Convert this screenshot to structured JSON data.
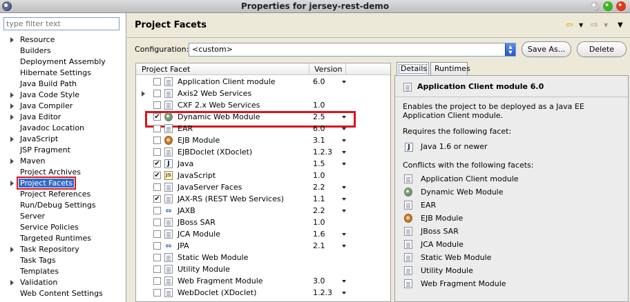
{
  "window": {
    "title": "Properties for jersey-rest-demo"
  },
  "sidebar": {
    "filter_placeholder": "type filter text",
    "items": [
      {
        "label": "Resource",
        "expandable": true
      },
      {
        "label": "Builders",
        "expandable": false
      },
      {
        "label": "Deployment Assembly",
        "expandable": false
      },
      {
        "label": "Hibernate Settings",
        "expandable": false
      },
      {
        "label": "Java Build Path",
        "expandable": false
      },
      {
        "label": "Java Code Style",
        "expandable": true
      },
      {
        "label": "Java Compiler",
        "expandable": true
      },
      {
        "label": "Java Editor",
        "expandable": true
      },
      {
        "label": "Javadoc Location",
        "expandable": false
      },
      {
        "label": "JavaScript",
        "expandable": true
      },
      {
        "label": "JSP Fragment",
        "expandable": false
      },
      {
        "label": "Maven",
        "expandable": true
      },
      {
        "label": "Project Archives",
        "expandable": false
      },
      {
        "label": "Project Facets",
        "expandable": true,
        "selected": true
      },
      {
        "label": "Project References",
        "expandable": false
      },
      {
        "label": "Run/Debug Settings",
        "expandable": false
      },
      {
        "label": "Server",
        "expandable": false
      },
      {
        "label": "Service Policies",
        "expandable": false
      },
      {
        "label": "Targeted Runtimes",
        "expandable": false
      },
      {
        "label": "Task Repository",
        "expandable": true
      },
      {
        "label": "Task Tags",
        "expandable": false
      },
      {
        "label": "Templates",
        "expandable": false
      },
      {
        "label": "Validation",
        "expandable": true
      },
      {
        "label": "Web Content Settings",
        "expandable": false
      }
    ]
  },
  "header": {
    "title": "Project Facets",
    "back_icon": "back-arrow-icon",
    "forward_icon": "forward-arrow-icon"
  },
  "configuration": {
    "label": "Configuration:",
    "value": "<custom>",
    "save_as_label": "Save As...",
    "delete_label": "Delete"
  },
  "facets": {
    "col_facet": "Project Facet",
    "col_version": "Version",
    "rows": [
      {
        "name": "Application Client module",
        "version": "6.0",
        "checked": false,
        "icon": "doc",
        "dropdown": true
      },
      {
        "name": "Axis2 Web Services",
        "version": "",
        "checked": false,
        "icon": "doc",
        "expandable": true,
        "dropdown": false
      },
      {
        "name": "CXF 2.x Web Services",
        "version": "1.0",
        "checked": false,
        "icon": "doc",
        "dropdown": false
      },
      {
        "name": "Dynamic Web Module",
        "version": "2.5",
        "checked": true,
        "icon": "globe",
        "dropdown": true,
        "highlight": true
      },
      {
        "name": "EAR",
        "version": "6.0",
        "checked": false,
        "icon": "doc",
        "dropdown": true
      },
      {
        "name": "EJB Module",
        "version": "3.1",
        "checked": false,
        "icon": "bean",
        "dropdown": true
      },
      {
        "name": "EJBDoclet (XDoclet)",
        "version": "1.2.3",
        "checked": false,
        "icon": "doc",
        "dropdown": true
      },
      {
        "name": "Java",
        "version": "1.5",
        "checked": true,
        "icon": "java",
        "dropdown": true
      },
      {
        "name": "JavaScript",
        "version": "1.0",
        "checked": true,
        "icon": "js",
        "dropdown": false
      },
      {
        "name": "JavaServer Faces",
        "version": "2.2",
        "checked": false,
        "icon": "doc",
        "dropdown": true
      },
      {
        "name": "JAX-RS (REST Web Services)",
        "version": "1.1",
        "checked": true,
        "icon": "doc",
        "dropdown": true
      },
      {
        "name": "JAXB",
        "version": "2.2",
        "checked": false,
        "icon": "arrows",
        "dropdown": true
      },
      {
        "name": "JBoss SAR",
        "version": "1.0",
        "checked": false,
        "icon": "doc",
        "dropdown": false
      },
      {
        "name": "JCA Module",
        "version": "1.6",
        "checked": false,
        "icon": "doc",
        "dropdown": true
      },
      {
        "name": "JPA",
        "version": "2.1",
        "checked": false,
        "icon": "arrows",
        "dropdown": true
      },
      {
        "name": "Static Web Module",
        "version": "",
        "checked": false,
        "icon": "doc",
        "dropdown": false
      },
      {
        "name": "Utility Module",
        "version": "",
        "checked": false,
        "icon": "doc",
        "dropdown": false
      },
      {
        "name": "Web Fragment Module",
        "version": "3.0",
        "checked": false,
        "icon": "doc",
        "dropdown": true
      },
      {
        "name": "WebDoclet (XDoclet)",
        "version": "1.2.3",
        "checked": false,
        "icon": "doc",
        "dropdown": true
      }
    ]
  },
  "details": {
    "tab_details": "Details",
    "tab_runtimes": "Runtimes",
    "title": "Application Client module 6.0",
    "description": "Enables the project to be deployed as a Java EE Application Client module.",
    "requires_heading": "Requires the following facet:",
    "requires_item": "Java 1.6 or newer",
    "conflicts_heading": "Conflicts with the following facets:",
    "conflicts": [
      {
        "name": "Application Client module",
        "icon": "doc"
      },
      {
        "name": "Dynamic Web Module",
        "icon": "globe"
      },
      {
        "name": "EAR",
        "icon": "doc"
      },
      {
        "name": "EJB Module",
        "icon": "bean"
      },
      {
        "name": "JBoss SAR",
        "icon": "doc"
      },
      {
        "name": "JCA Module",
        "icon": "doc"
      },
      {
        "name": "Static Web Module",
        "icon": "doc"
      },
      {
        "name": "Utility Module",
        "icon": "doc"
      },
      {
        "name": "Web Fragment Module",
        "icon": "doc"
      }
    ]
  },
  "colors": {
    "selection": "#316ac5",
    "highlight_border": "#d8141e"
  }
}
